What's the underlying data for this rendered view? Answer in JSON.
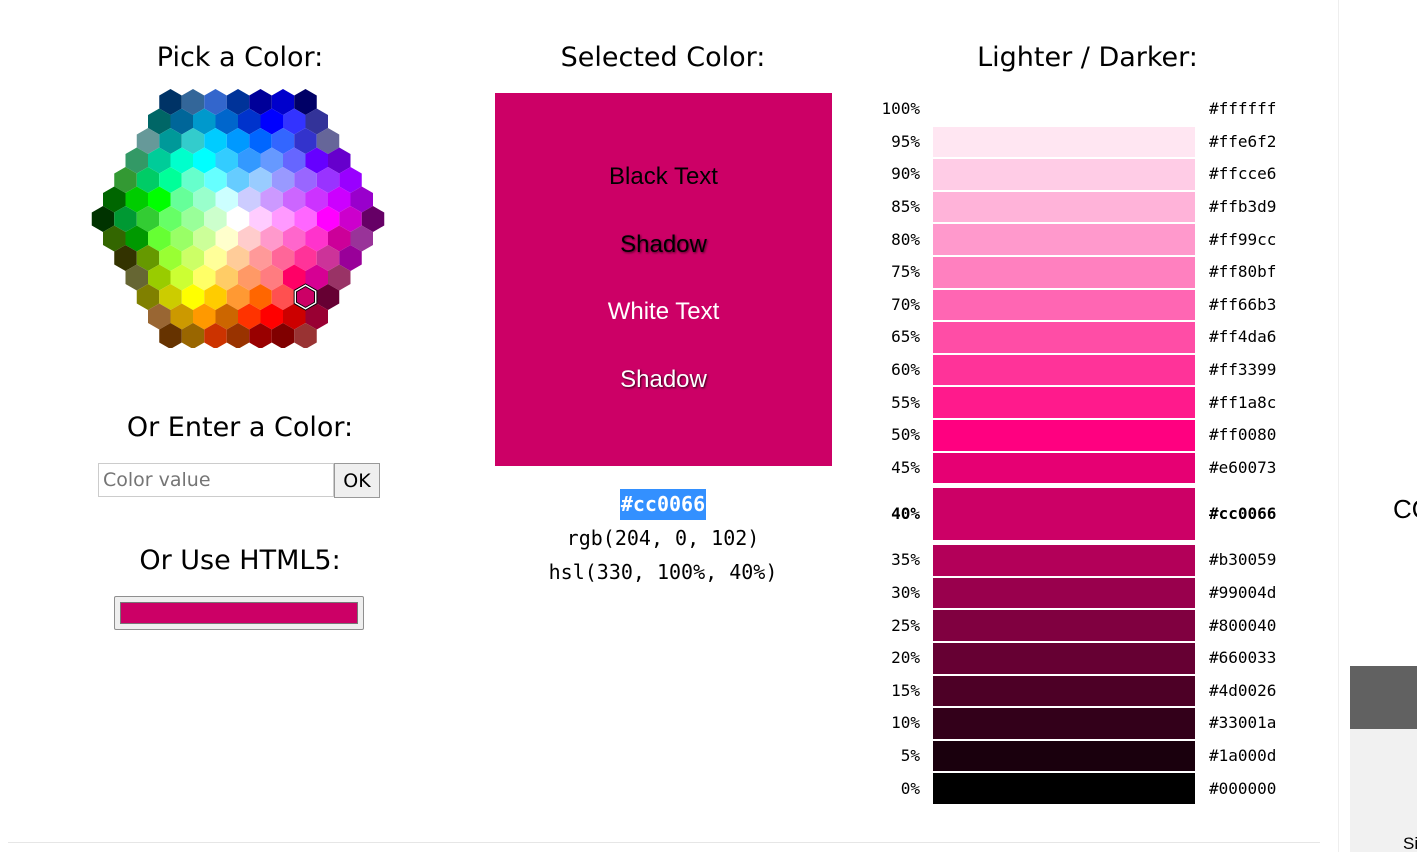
{
  "pick": {
    "title": "Pick a Color:"
  },
  "enter": {
    "title": "Or Enter a Color:",
    "placeholder": "Color value",
    "ok_label": "OK"
  },
  "html5": {
    "title": "Or Use HTML5:",
    "value": "#cc0066"
  },
  "selected": {
    "title": "Selected Color:",
    "color": "#cc0066",
    "preview_lines": [
      "Black Text",
      "Shadow",
      "White Text",
      "Shadow"
    ],
    "hex": "#cc0066",
    "rgb": "rgb(204, 0, 102)",
    "hsl": "hsl(330, 100%, 40%)"
  },
  "shades": {
    "title": "Lighter / Darker:",
    "rows": [
      {
        "pct": "100%",
        "hex": "#ffffff"
      },
      {
        "pct": "95%",
        "hex": "#ffe6f2"
      },
      {
        "pct": "90%",
        "hex": "#ffcce6"
      },
      {
        "pct": "85%",
        "hex": "#ffb3d9"
      },
      {
        "pct": "80%",
        "hex": "#ff99cc"
      },
      {
        "pct": "75%",
        "hex": "#ff80bf"
      },
      {
        "pct": "70%",
        "hex": "#ff66b3"
      },
      {
        "pct": "65%",
        "hex": "#ff4da6"
      },
      {
        "pct": "60%",
        "hex": "#ff3399"
      },
      {
        "pct": "55%",
        "hex": "#ff1a8c"
      },
      {
        "pct": "50%",
        "hex": "#ff0080"
      },
      {
        "pct": "45%",
        "hex": "#e60073"
      },
      {
        "pct": "40%",
        "hex": "#cc0066",
        "current": true
      },
      {
        "pct": "35%",
        "hex": "#b30059"
      },
      {
        "pct": "30%",
        "hex": "#99004d"
      },
      {
        "pct": "25%",
        "hex": "#800040"
      },
      {
        "pct": "20%",
        "hex": "#660033"
      },
      {
        "pct": "15%",
        "hex": "#4d0026"
      },
      {
        "pct": "10%",
        "hex": "#33001a"
      },
      {
        "pct": "5%",
        "hex": "#1a000d"
      },
      {
        "pct": "0%",
        "hex": "#000000"
      }
    ]
  },
  "hexmap": {
    "rows": [
      [
        "#003366",
        "#336699",
        "#3366CC",
        "#003399",
        "#000099",
        "#0000CC",
        "#000066"
      ],
      [
        "#006666",
        "#006699",
        "#0099CC",
        "#0066CC",
        "#0033CC",
        "#0000FF",
        "#3333FF",
        "#333399"
      ],
      [
        "#669999",
        "#009999",
        "#33CCCC",
        "#00CCFF",
        "#0099FF",
        "#0066FF",
        "#3366FF",
        "#3333CC",
        "#666699"
      ],
      [
        "#339966",
        "#00CC99",
        "#00FFCC",
        "#00FFFF",
        "#33CCFF",
        "#3399FF",
        "#6699FF",
        "#6666FF",
        "#6600FF",
        "#6600CC"
      ],
      [
        "#339933",
        "#00CC66",
        "#00FF99",
        "#66FFCC",
        "#66FFFF",
        "#66CCFF",
        "#99CCFF",
        "#9999FF",
        "#9966FF",
        "#9933FF",
        "#9900FF"
      ],
      [
        "#006600",
        "#00CC00",
        "#00FF00",
        "#66FF99",
        "#99FFCC",
        "#CCFFFF",
        "#CCCCFF",
        "#CC99FF",
        "#CC66FF",
        "#CC33FF",
        "#CC00FF",
        "#9900CC"
      ],
      [
        "#003300",
        "#009933",
        "#33CC33",
        "#66FF66",
        "#99FF99",
        "#CCFFCC",
        "#FFFFFF",
        "#FFCCFF",
        "#FF99FF",
        "#FF66FF",
        "#FF00FF",
        "#CC00CC",
        "#660066"
      ],
      [
        "#336600",
        "#009900",
        "#66FF33",
        "#99FF66",
        "#CCFF99",
        "#FFFFCC",
        "#FFCCCC",
        "#FF99CC",
        "#FF66CC",
        "#FF33CC",
        "#CC0099",
        "#993399"
      ],
      [
        "#333300",
        "#669900",
        "#99FF33",
        "#CCFF66",
        "#FFFF99",
        "#FFCC99",
        "#FF9999",
        "#FF6699",
        "#FF3399",
        "#CC3399",
        "#990099"
      ],
      [
        "#666633",
        "#99CC00",
        "#CCFF33",
        "#FFFF66",
        "#FFCC66",
        "#FF9966",
        "#FF7C80",
        "#FF0066",
        "#D60093",
        "#993366"
      ],
      [
        "#808000",
        "#CCCC00",
        "#FFFF00",
        "#FFCC00",
        "#FF9933",
        "#FF6600",
        "#FF5050",
        "#CC0066",
        "#660033"
      ],
      [
        "#996633",
        "#CC9900",
        "#FF9900",
        "#CC6600",
        "#FF3300",
        "#FF0000",
        "#CC0000",
        "#990033"
      ],
      [
        "#663300",
        "#996600",
        "#CC3300",
        "#993300",
        "#990000",
        "#800000",
        "#993333"
      ]
    ],
    "selected": "#CC0066"
  }
}
